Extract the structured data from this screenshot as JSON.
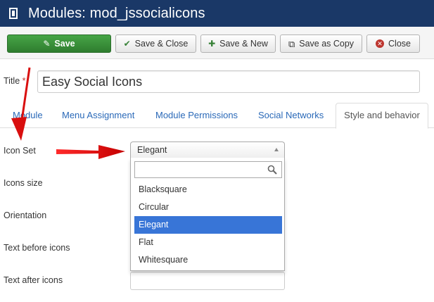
{
  "header": {
    "title": "Modules: mod_jssocialicons",
    "logo_icon": "joomla-logo-icon"
  },
  "toolbar": {
    "save_label": "Save",
    "save_close_label": "Save & Close",
    "save_new_label": "Save & New",
    "save_copy_label": "Save as Copy",
    "close_label": "Close"
  },
  "form": {
    "title_label": "Title",
    "title_required_mark": "*",
    "title_value": "Easy Social Icons"
  },
  "tabs": [
    {
      "label": "Module"
    },
    {
      "label": "Menu Assignment"
    },
    {
      "label": "Module Permissions"
    },
    {
      "label": "Social Networks"
    },
    {
      "label": "Style and behavior",
      "active": true
    }
  ],
  "fields": {
    "icon_set_label": "Icon Set",
    "icons_size_label": "Icons size",
    "orientation_label": "Orientation",
    "text_before_label": "Text before icons",
    "text_after_label": "Text after icons"
  },
  "icon_set_select": {
    "selected": "Elegant",
    "search_value": "",
    "options": [
      "Blacksquare",
      "Circular",
      "Elegant",
      "Flat",
      "Whitesquare"
    ],
    "highlighted": "Elegant"
  },
  "colors": {
    "header_bg": "#1a3867",
    "save_green": "#3c9a3c",
    "link_blue": "#2a69b8",
    "highlight_blue": "#3875d7",
    "arrow_red": "#d90f0f"
  }
}
